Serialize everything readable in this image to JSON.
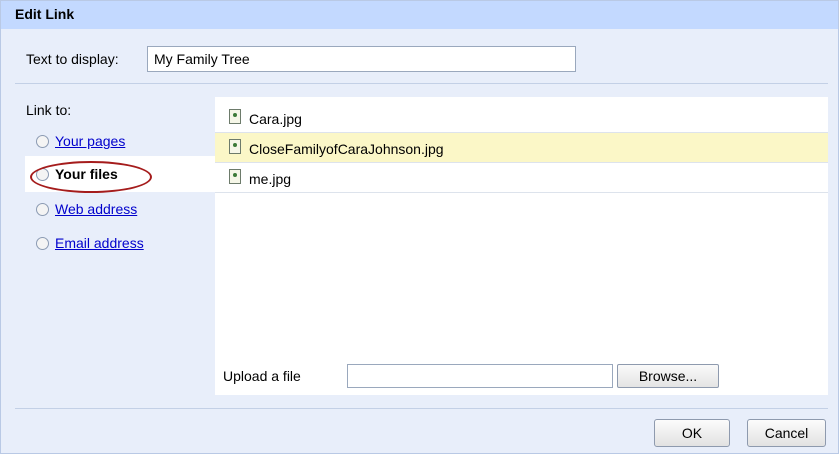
{
  "dialog": {
    "title": "Edit Link",
    "text_to_display_label": "Text to display:",
    "text_to_display_value": "My Family Tree",
    "link_to_label": "Link to:",
    "options": [
      {
        "label": "Your pages",
        "selected": false
      },
      {
        "label": "Your files",
        "selected": true
      },
      {
        "label": "Web address",
        "selected": false
      },
      {
        "label": "Email address",
        "selected": false
      }
    ],
    "files": [
      {
        "name": "Cara.jpg",
        "icon": "image-file-icon",
        "selected": false
      },
      {
        "name": "CloseFamilyofCaraJohnson.jpg",
        "icon": "image-file-icon",
        "selected": true
      },
      {
        "name": "me.jpg",
        "icon": "image-file-icon",
        "selected": false
      }
    ],
    "upload_label": "Upload a file",
    "upload_value": "",
    "browse_label": "Browse...",
    "ok_label": "OK",
    "cancel_label": "Cancel"
  },
  "colors": {
    "titlebar": "#c3d9ff",
    "dialog_bg": "#e8eefa",
    "selected_row": "#fbf7c7",
    "link": "#0000cc",
    "highlight_oval": "#a51c1c"
  }
}
